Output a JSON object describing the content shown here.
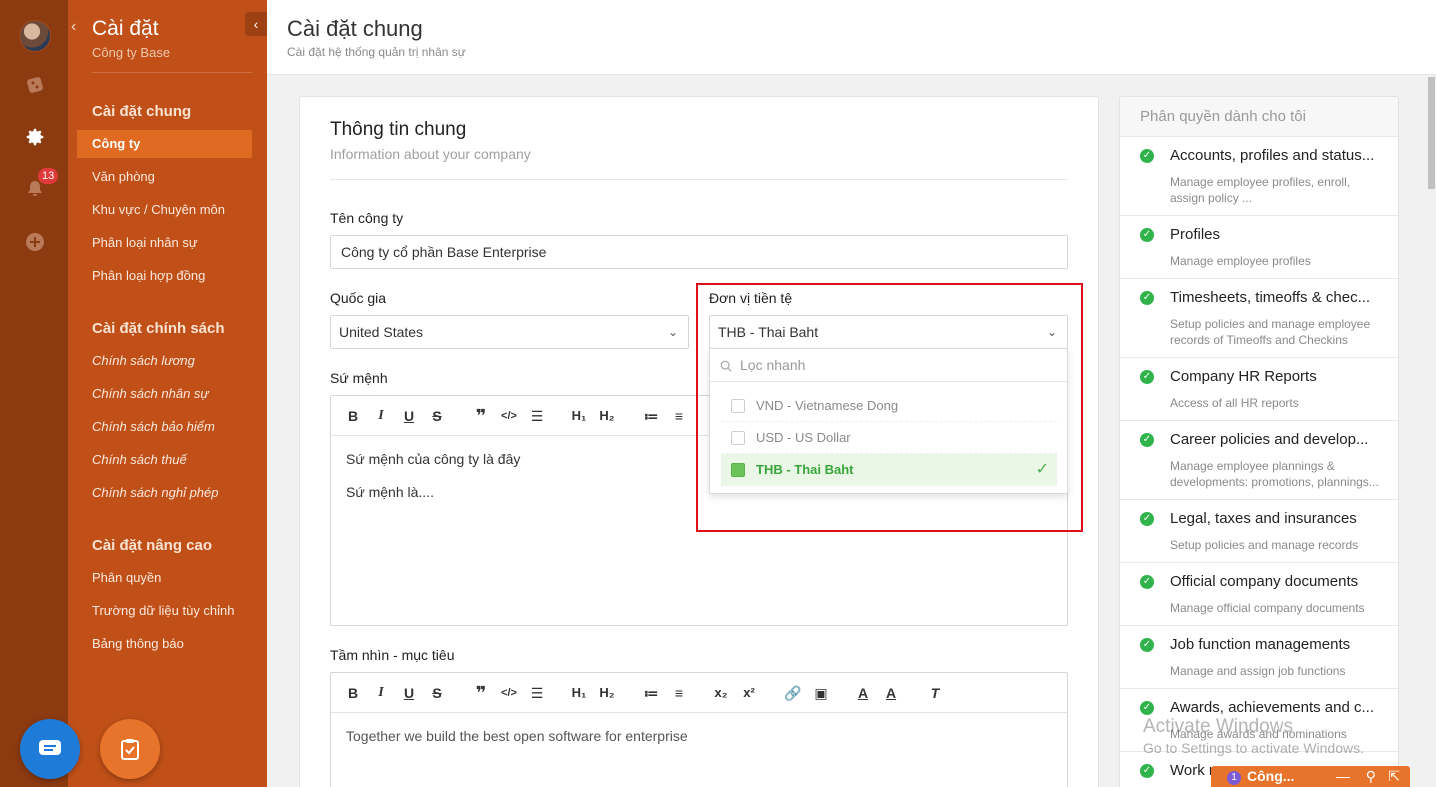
{
  "nav": {
    "title": "Cài đặt",
    "subtitle": "Công ty Base",
    "notification_count": "13",
    "groups": [
      {
        "label": "Cài đặt chung",
        "items": [
          "Công ty",
          "Văn phòng",
          "Khu vực / Chuyên môn",
          "Phân loại nhân sự",
          "Phân loại hợp đồng"
        ]
      },
      {
        "label": "Cài đặt chính sách",
        "items": [
          "Chính sách lương",
          "Chính sách nhân sự",
          "Chính sách bảo hiểm",
          "Chính sách thuế",
          "Chính sách nghỉ phép"
        ]
      },
      {
        "label": "Cài đặt nâng cao",
        "items": [
          "Phân quyền",
          "Trường dữ liệu tùy chỉnh",
          "Bảng thông báo"
        ]
      }
    ],
    "active_item": "Công ty"
  },
  "header": {
    "title": "Cài đặt chung",
    "subtitle": "Cài đặt hệ thống quản trị nhân sự"
  },
  "card": {
    "title": "Thông tin chung",
    "subtitle": "Information about your company",
    "company_name_label": "Tên công ty",
    "company_name_value": "Công ty cổ phần Base Enterprise",
    "country_label": "Quốc gia",
    "country_value": "United States",
    "currency_label": "Đơn vị tiền tệ",
    "currency_value": "THB - Thai Baht",
    "mission_label": "Sứ mệnh",
    "mission_lines": [
      "Sứ mệnh của công ty là đây",
      "Sứ mệnh là...."
    ],
    "vision_label": "Tầm nhìn - mục tiêu",
    "vision_text": "Together we build the best open software for enterprise"
  },
  "currency_dropdown": {
    "search_placeholder": "Lọc nhanh",
    "options": [
      "VND - Vietnamese Dong",
      "USD - US Dollar",
      "THB - Thai Baht"
    ],
    "selected": "THB - Thai Baht"
  },
  "permissions": {
    "title": "Phân quyền dành cho tôi",
    "items": [
      {
        "title": "Accounts, profiles and status...",
        "desc": "Manage employee profiles, enroll, assign policy ..."
      },
      {
        "title": "Profiles",
        "desc": "Manage employee profiles"
      },
      {
        "title": "Timesheets, timeoffs & chec...",
        "desc": "Setup policies and manage employee records of Timeoffs and Checkins"
      },
      {
        "title": "Company HR Reports",
        "desc": "Access of all HR reports"
      },
      {
        "title": "Career policies and develop...",
        "desc": "Manage employee plannings & developments: promotions, plannings..."
      },
      {
        "title": "Legal, taxes and insurances",
        "desc": "Setup policies and manage records"
      },
      {
        "title": "Official company documents",
        "desc": "Manage official company documents"
      },
      {
        "title": "Job function managements",
        "desc": "Manage and assign job functions"
      },
      {
        "title": "Awards, achievements and c...",
        "desc": "Manage awards and nominations"
      },
      {
        "title": "Work r",
        "desc": ""
      }
    ]
  },
  "watermark": {
    "line1": "Activate Windows",
    "line2": "Go to Settings to activate Windows."
  },
  "chat_bar": {
    "count": "1",
    "title": "Công..."
  },
  "colors": {
    "rail": "#8c3a10",
    "nav": "#c05018",
    "active": "#e06a22",
    "check": "#2fb34a",
    "highlight_box": "#e0101a"
  }
}
